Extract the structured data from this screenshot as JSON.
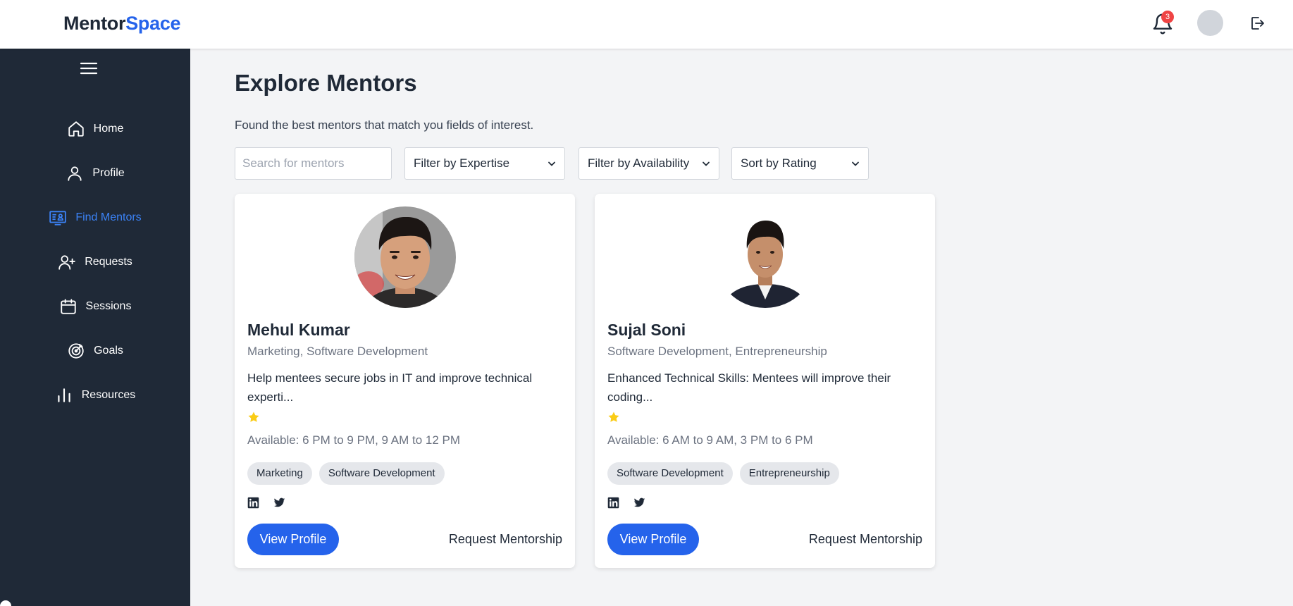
{
  "header": {
    "logo_primary": "Mentor",
    "logo_accent": "Space",
    "notification_count": "3"
  },
  "sidebar": {
    "items": [
      {
        "label": "Home",
        "icon": "home-icon"
      },
      {
        "label": "Profile",
        "icon": "user-icon"
      },
      {
        "label": "Find Mentors",
        "icon": "mentors-icon",
        "active": true
      },
      {
        "label": "Requests",
        "icon": "user-plus-icon"
      },
      {
        "label": "Sessions",
        "icon": "calendar-icon"
      },
      {
        "label": "Goals",
        "icon": "target-icon"
      },
      {
        "label": "Resources",
        "icon": "bar-chart-icon"
      }
    ]
  },
  "main": {
    "title": "Explore Mentors",
    "subtitle": "Found the best mentors that match you fields of interest.",
    "search_placeholder": "Search for mentors",
    "filters": {
      "expertise": "Filter by Expertise",
      "availability": "Filter by Availability",
      "sort": "Sort by Rating"
    },
    "mentors": [
      {
        "name": "Mehul Kumar",
        "expertise": "Marketing, Software Development",
        "description": "Help mentees secure jobs in IT and improve technical experti...",
        "rating_stars": 1,
        "availability": "Available: 6 PM to 9 PM, 9 AM to 12 PM",
        "tags": [
          "Marketing",
          "Software Development"
        ],
        "view_label": "View Profile",
        "request_label": "Request Mentorship"
      },
      {
        "name": "Sujal Soni",
        "expertise": "Software Development, Entrepreneurship",
        "description": "Enhanced Technical Skills: Mentees will improve their coding...",
        "rating_stars": 1,
        "availability": "Available: 6 AM to 9 AM, 3 PM to 6 PM",
        "tags": [
          "Software Development",
          "Entrepreneurship"
        ],
        "view_label": "View Profile",
        "request_label": "Request Mentorship"
      }
    ]
  },
  "colors": {
    "accent": "#2563eb",
    "sidebar_bg": "#1f2937",
    "active_nav": "#3b82f6",
    "badge": "#ef4444",
    "star": "#facc15"
  }
}
